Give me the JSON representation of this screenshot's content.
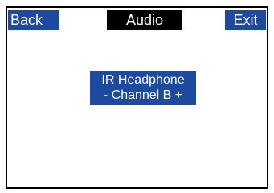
{
  "header": {
    "back_label": "Back",
    "title": "Audio",
    "exit_label": "Exit"
  },
  "main": {
    "item_line1": "IR Headphone",
    "item_line2": "- Channel B +"
  },
  "colors": {
    "button_blue": "#1b4aa0",
    "title_black": "#000000",
    "text_white": "#ffffff"
  }
}
